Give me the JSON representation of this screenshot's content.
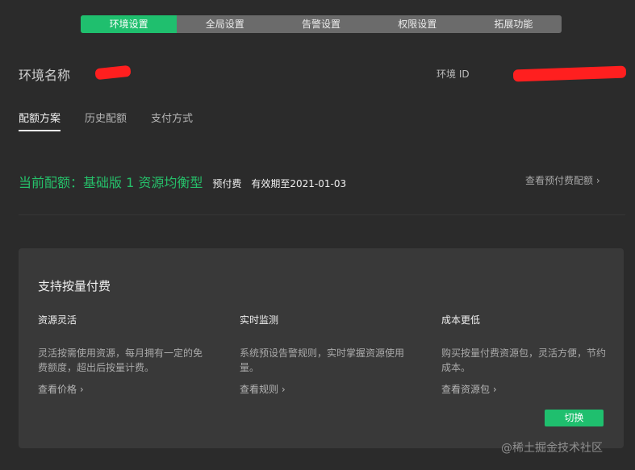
{
  "top_tabs": [
    "环境设置",
    "全局设置",
    "告警设置",
    "权限设置",
    "拓展功能"
  ],
  "env": {
    "name_label": "环境名称",
    "id_label": "环境 ID"
  },
  "sub_tabs": [
    "配额方案",
    "历史配额",
    "支付方式"
  ],
  "quota": {
    "title": "当前配额：基础版 1 资源均衡型",
    "tag": "预付费",
    "expiry": "有效期至2021-01-03",
    "view_link": "查看预付费配额 ›"
  },
  "card": {
    "title": "支持按量付费",
    "features": [
      {
        "title": "资源灵活",
        "desc": "灵活按需使用资源，每月拥有一定的免费额度，超出后按量计费。",
        "link": "查看价格 ›"
      },
      {
        "title": "实时监测",
        "desc": "系统预设告警规则，实时掌握资源使用量。",
        "link": "查看规则 ›"
      },
      {
        "title": "成本更低",
        "desc": "购买按量付费资源包，灵活方便，节约成本。",
        "link": "查看资源包 ›"
      }
    ],
    "switch_label": "切换"
  },
  "watermark": "@稀土掘金技术社区",
  "colors": {
    "accent": "#1fbf6e",
    "redaction": "#ff1f1f",
    "background": "#2b2b2b"
  }
}
